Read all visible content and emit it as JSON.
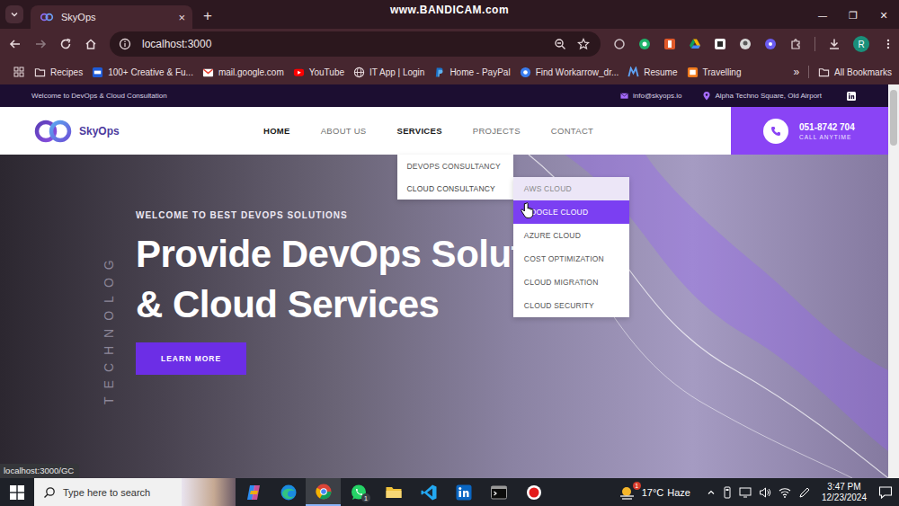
{
  "browser": {
    "tabs": [
      {
        "title": "SkyOps",
        "selected": true,
        "close": "×"
      }
    ],
    "new_tab": "+",
    "watermark": "www.BANDICAM.com",
    "window_controls": [
      "—",
      "❐",
      "✕"
    ],
    "url": "localhost:3000",
    "profile_initial": "R",
    "bookmarks": [
      {
        "label": "Recipes",
        "kind": "folder"
      },
      {
        "label": "100+ Creative & Fu...",
        "kind": "creative"
      },
      {
        "label": "mail.google.com",
        "kind": "gmail"
      },
      {
        "label": "YouTube",
        "kind": "youtube"
      },
      {
        "label": "IT App | Login",
        "kind": "globe"
      },
      {
        "label": "Home - PayPal",
        "kind": "paypal"
      },
      {
        "label": "Find Workarrow_dr...",
        "kind": "workarrow"
      },
      {
        "label": "Resume",
        "kind": "resume"
      },
      {
        "label": "Travelling",
        "kind": "travel"
      }
    ],
    "bookmarks_more": "»",
    "all_bookmarks": "All Bookmarks"
  },
  "site": {
    "top_bar": {
      "welcome": "Welcome to DevOps & Cloud Consultation",
      "email": "info@skyops.io",
      "address": "Alpha Techno Square, Old Airport"
    },
    "logo": "SkyOps",
    "nav": [
      {
        "label": "HOME",
        "selected": true,
        "expanded": false
      },
      {
        "label": "ABOUT US",
        "selected": false,
        "expanded": false
      },
      {
        "label": "SERVICES",
        "selected": false,
        "expanded": true
      },
      {
        "label": "PROJECTS",
        "selected": false,
        "expanded": false
      },
      {
        "label": "CONTACT",
        "selected": false,
        "expanded": false
      }
    ],
    "services_menu": [
      {
        "label": "DEVOPS CONSULTANCY",
        "expanded": false
      },
      {
        "label": "CLOUD CONSULTANCY",
        "expanded": true
      }
    ],
    "cloud_menu": [
      {
        "label": "AWS CLOUD",
        "selected": false,
        "tinted": true
      },
      {
        "label": "GOOGLE CLOUD",
        "selected": true,
        "tinted": false
      },
      {
        "label": "AZURE CLOUD",
        "selected": false,
        "tinted": false
      },
      {
        "label": "COST OPTIMIZATION",
        "selected": false,
        "tinted": false
      },
      {
        "label": "CLOUD MIGRATION",
        "selected": false,
        "tinted": false
      },
      {
        "label": "CLOUD SECURITY",
        "selected": false,
        "tinted": false
      }
    ],
    "phone": {
      "number": "051-8742 704",
      "caption": "CALL ANYTIME"
    },
    "hero": {
      "eyebrow": "WELCOME TO BEST DEVOPS SOLUTIONS",
      "title_lines": [
        "Provide DevOps Solutions",
        "& Cloud Services"
      ],
      "button": "LEARN MORE",
      "side_text": "TECHNOLOG"
    }
  },
  "status_link": "localhost:3000/GC",
  "taskbar": {
    "search_placeholder": "Type here to search",
    "apps": [
      {
        "kind": "copilot",
        "selected": false
      },
      {
        "kind": "edge",
        "selected": false
      },
      {
        "kind": "chrome",
        "selected": true
      },
      {
        "kind": "whatsapp",
        "selected": false,
        "badge": "1"
      },
      {
        "kind": "explorer",
        "selected": false
      },
      {
        "kind": "vscode",
        "selected": false
      },
      {
        "kind": "linkedin",
        "selected": false
      },
      {
        "kind": "terminal",
        "selected": false
      },
      {
        "kind": "recorder",
        "selected": false
      }
    ],
    "weather": {
      "temp": "17°C",
      "desc": "Haze",
      "badge": "1"
    },
    "time": "3:47 PM",
    "date": "12/23/2024"
  }
}
